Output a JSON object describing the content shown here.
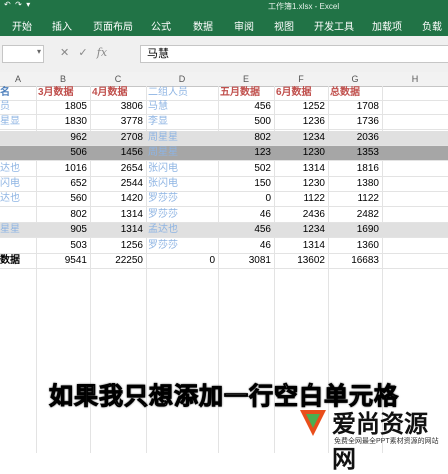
{
  "window": {
    "title": "工作簿1.xlsx - Excel"
  },
  "ribbon": {
    "tabs": [
      "开始",
      "插入",
      "页面布局",
      "公式",
      "数据",
      "审阅",
      "视图",
      "开发工具",
      "加载项",
      "负载测试"
    ]
  },
  "formula_bar": {
    "value": "马慧",
    "fx_label": "fx"
  },
  "columns": [
    "A",
    "B",
    "C",
    "D",
    "E",
    "F",
    "G",
    "H"
  ],
  "headers": {
    "b": "3月数据",
    "c": "4月数据",
    "d": "二组人员",
    "e": "五月数据",
    "f": "6月数据",
    "g": "总数据"
  },
  "rows": [
    {
      "a": "员",
      "b": "1805",
      "c": "3806",
      "d": "马慧",
      "e": "456",
      "f": "1252",
      "g": "1708"
    },
    {
      "a": "星显",
      "b": "1830",
      "c": "3778",
      "d": "李显",
      "e": "500",
      "f": "1236",
      "g": "1736"
    },
    {
      "a": "",
      "b": "962",
      "c": "2708",
      "d": "周星星",
      "e": "802",
      "f": "1234",
      "g": "2036"
    },
    {
      "a": "",
      "b": "506",
      "c": "1456",
      "d": "周星星",
      "e": "123",
      "f": "1230",
      "g": "1353"
    },
    {
      "a": "达也",
      "b": "1016",
      "c": "2654",
      "d": "张闪电",
      "e": "502",
      "f": "1314",
      "g": "1816"
    },
    {
      "a": "闪电",
      "b": "652",
      "c": "2544",
      "d": "张闪电",
      "e": "150",
      "f": "1230",
      "g": "1380"
    },
    {
      "a": "达也",
      "b": "560",
      "c": "1420",
      "d": "罗莎莎",
      "e": "0",
      "f": "1122",
      "g": "1122"
    },
    {
      "a": "",
      "b": "802",
      "c": "1314",
      "d": "罗莎莎",
      "e": "46",
      "f": "2436",
      "g": "2482"
    },
    {
      "a": "星星",
      "b": "905",
      "c": "1314",
      "d": "孟达也",
      "e": "456",
      "f": "1234",
      "g": "1690"
    },
    {
      "a": "",
      "b": "503",
      "c": "1256",
      "d": "罗莎莎",
      "e": "46",
      "f": "1314",
      "g": "1360"
    }
  ],
  "total_row": {
    "a": "数据",
    "b": "9541",
    "c": "22250",
    "d": "0",
    "e": "3081",
    "f": "13602",
    "g": "16683"
  },
  "subtitle": "如果我只想添加一行空白单元格",
  "watermark": {
    "main": "爱尚资源网",
    "sub": "免费全网最全PPT素材资源的网站"
  }
}
